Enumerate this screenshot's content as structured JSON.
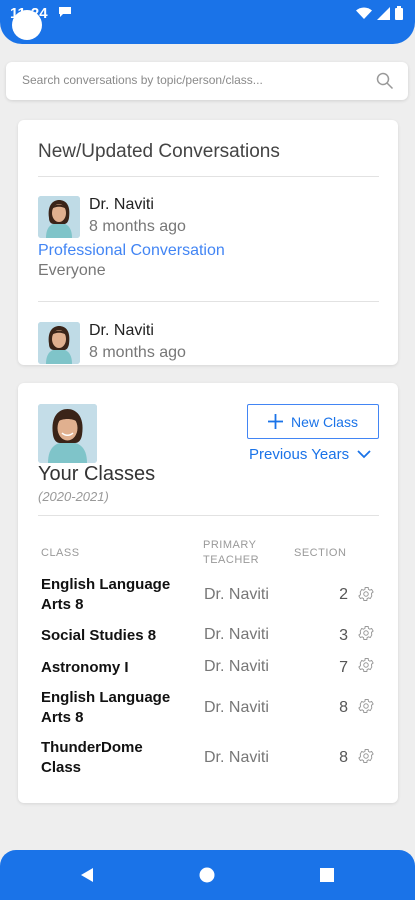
{
  "status_bar": {
    "time": "11:24"
  },
  "search": {
    "placeholder": "Search conversations by topic/person/class..."
  },
  "conversations": {
    "title": "New/Updated Conversations",
    "items": [
      {
        "name": "Dr. Naviti",
        "time": "8 months ago",
        "topic": "Professional Conversation",
        "audience": "Everyone"
      },
      {
        "name": "Dr. Naviti",
        "time": "8 months ago"
      }
    ]
  },
  "classes": {
    "new_class_label": "New Class",
    "previous_years_label": "Previous Years",
    "title": "Your Classes",
    "year_range": "(2020-2021)",
    "columns": {
      "class": "CLASS",
      "primary_teacher_line1": "PRIMARY",
      "primary_teacher_line2": "TEACHER",
      "section": "SECTION"
    },
    "rows": [
      {
        "name_line1": "English Language",
        "name_line2": "Arts 8",
        "teacher": "Dr. Naviti",
        "section": "2"
      },
      {
        "name_line1": "Social Studies 8",
        "name_line2": "",
        "teacher": "Dr. Naviti",
        "section": "3"
      },
      {
        "name_line1": "Astronomy I",
        "name_line2": "",
        "teacher": "Dr. Naviti",
        "section": "7"
      },
      {
        "name_line1": "English Language",
        "name_line2": "Arts 8",
        "teacher": "Dr. Naviti",
        "section": "8"
      },
      {
        "name_line1": "ThunderDome",
        "name_line2": "Class",
        "teacher": "Dr. Naviti",
        "section": "8"
      }
    ]
  },
  "colors": {
    "accent": "#1a73e8",
    "link": "#4285f4"
  },
  "icons": {
    "status": [
      "chat-notification-icon",
      "wifi-icon",
      "cell-signal-icon",
      "battery-icon"
    ],
    "search": "search-icon",
    "new_class": "plus-icon",
    "previous_years": "chevron-down-icon",
    "row_action": "gear-icon",
    "nav": [
      "back-icon",
      "home-icon",
      "recents-icon"
    ]
  }
}
